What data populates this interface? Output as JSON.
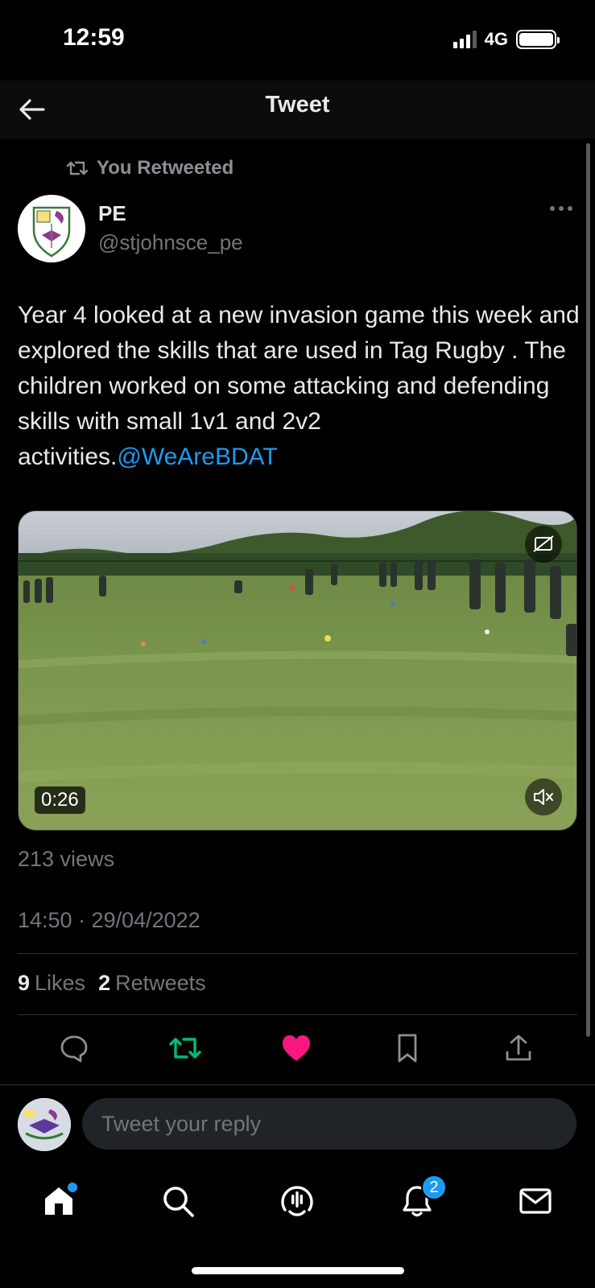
{
  "status_bar": {
    "time": "12:59",
    "network": "4G"
  },
  "header": {
    "title": "Tweet",
    "back_icon": "arrow-left-icon"
  },
  "retweet_context": {
    "label": "You Retweeted",
    "icon": "retweet-icon"
  },
  "author": {
    "name": "PE",
    "handle": "@stjohnsce_pe"
  },
  "tweet": {
    "text": "Year 4 looked at a new invasion game this week and explored the skills that are used in Tag Rugby . The children worked on some attacking and defending skills with small 1v1 and 2v2 activities.",
    "mention": "@WeAreBDAT"
  },
  "media": {
    "duration": "0:26",
    "cc_icon": "closed-captions-icon",
    "mute_icon": "speaker-muted-icon"
  },
  "views": "213 views",
  "timestamp": "14:50 · 29/04/2022",
  "engagement": {
    "likes_count": "9",
    "likes_label": "Likes",
    "retweets_count": "2",
    "retweets_label": "Retweets"
  },
  "actions": [
    "reply-icon",
    "retweet-icon",
    "like-icon",
    "bookmark-icon",
    "share-icon"
  ],
  "colors": {
    "retweet_active": "#00ba7c",
    "like_active": "#f91880",
    "link": "#1d9bf0"
  },
  "reply": {
    "placeholder": "Tweet your reply"
  },
  "tab_bar": {
    "items": [
      "home-icon",
      "search-icon",
      "spaces-icon",
      "notifications-icon",
      "messages-icon"
    ],
    "notifications_badge": "2"
  }
}
